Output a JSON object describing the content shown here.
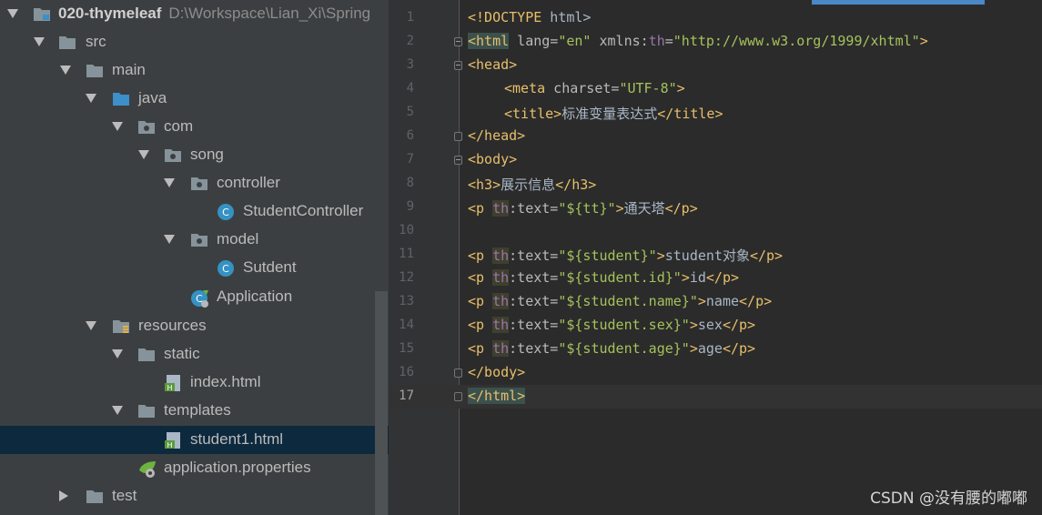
{
  "project_tree": {
    "root": {
      "name": "020-thymeleaf",
      "path": "D:\\Workspace\\Lian_Xi\\Spring"
    },
    "items": [
      {
        "label": "src",
        "icon": "folder-icon"
      },
      {
        "label": "main",
        "icon": "folder-icon"
      },
      {
        "label": "java",
        "icon": "source-folder-icon"
      },
      {
        "label": "com",
        "icon": "package-icon"
      },
      {
        "label": "song",
        "icon": "package-icon"
      },
      {
        "label": "controller",
        "icon": "package-icon"
      },
      {
        "label": "StudentController",
        "icon": "class-icon"
      },
      {
        "label": "model",
        "icon": "package-icon"
      },
      {
        "label": "Sutdent",
        "icon": "class-icon"
      },
      {
        "label": "Application",
        "icon": "spring-boot-class-icon"
      },
      {
        "label": "resources",
        "icon": "resources-folder-icon"
      },
      {
        "label": "static",
        "icon": "folder-icon"
      },
      {
        "label": "index.html",
        "icon": "html-file-icon"
      },
      {
        "label": "templates",
        "icon": "folder-icon"
      },
      {
        "label": "student1.html",
        "icon": "html-file-icon",
        "selected": true
      },
      {
        "label": "application.properties",
        "icon": "spring-properties-icon"
      },
      {
        "label": "test",
        "icon": "folder-icon"
      }
    ]
  },
  "editor": {
    "current_line": 17,
    "line_numbers": [
      "1",
      "2",
      "3",
      "4",
      "5",
      "6",
      "7",
      "8",
      "9",
      "10",
      "11",
      "12",
      "13",
      "14",
      "15",
      "16",
      "17"
    ],
    "lines": {
      "l1": {
        "tag": "<!DOCTYPE",
        "rest": " html>"
      },
      "l2": {
        "open": "<html",
        "a1": " lang=",
        "v1": "\"en\"",
        "a2": " xmlns:",
        "ns": "th",
        "eq": "=",
        "v2": "\"http://www.w3.org/1999/xhtml\"",
        "close": ">"
      },
      "l3": {
        "open": "<head>"
      },
      "l4": {
        "open": "<meta",
        "a1": " charset=",
        "v1": "\"UTF-8\"",
        "close": ">"
      },
      "l5": {
        "open": "<title>",
        "text": "标准变量表达式",
        "close": "</title>"
      },
      "l6": {
        "open": "</head>"
      },
      "l7": {
        "open": "<body>"
      },
      "l8": {
        "open": "<h3>",
        "text": "展示信息",
        "close": "</h3>"
      },
      "l9": {
        "open": "<p",
        "th": "th",
        "attr": ":text=",
        "val": "\"${tt}\"",
        "gt": ">",
        "text": "通天塔",
        "close": "</p>"
      },
      "l11": {
        "open": "<p",
        "th": "th",
        "attr": ":text=",
        "val": "\"${student}\"",
        "gt": ">",
        "text": "student对象",
        "close": "</p>"
      },
      "l12": {
        "open": "<p",
        "th": "th",
        "attr": ":text=",
        "val": "\"${student.id}\"",
        "gt": ">",
        "text": "id",
        "close": "</p>"
      },
      "l13": {
        "open": "<p",
        "th": "th",
        "attr": ":text=",
        "val": "\"${student.name}\"",
        "gt": ">",
        "text": "name",
        "close": "</p>"
      },
      "l14": {
        "open": "<p",
        "th": "th",
        "attr": ":text=",
        "val": "\"${student.sex}\"",
        "gt": ">",
        "text": "sex",
        "close": "</p>"
      },
      "l15": {
        "open": "<p",
        "th": "th",
        "attr": ":text=",
        "val": "\"${student.age}\"",
        "gt": ">",
        "text": "age",
        "close": "</p>"
      },
      "l16": {
        "open": "</body>"
      },
      "l17": {
        "open": "</html>"
      }
    }
  },
  "watermark": "CSDN @没有腰的嘟嘟",
  "colors": {
    "tree_bg": "#3c3f41",
    "editor_bg": "#2b2b2b",
    "selection": "#0d293e",
    "tag": "#e8bf6a",
    "string": "#a5c25c",
    "namespace": "#9876aa"
  }
}
